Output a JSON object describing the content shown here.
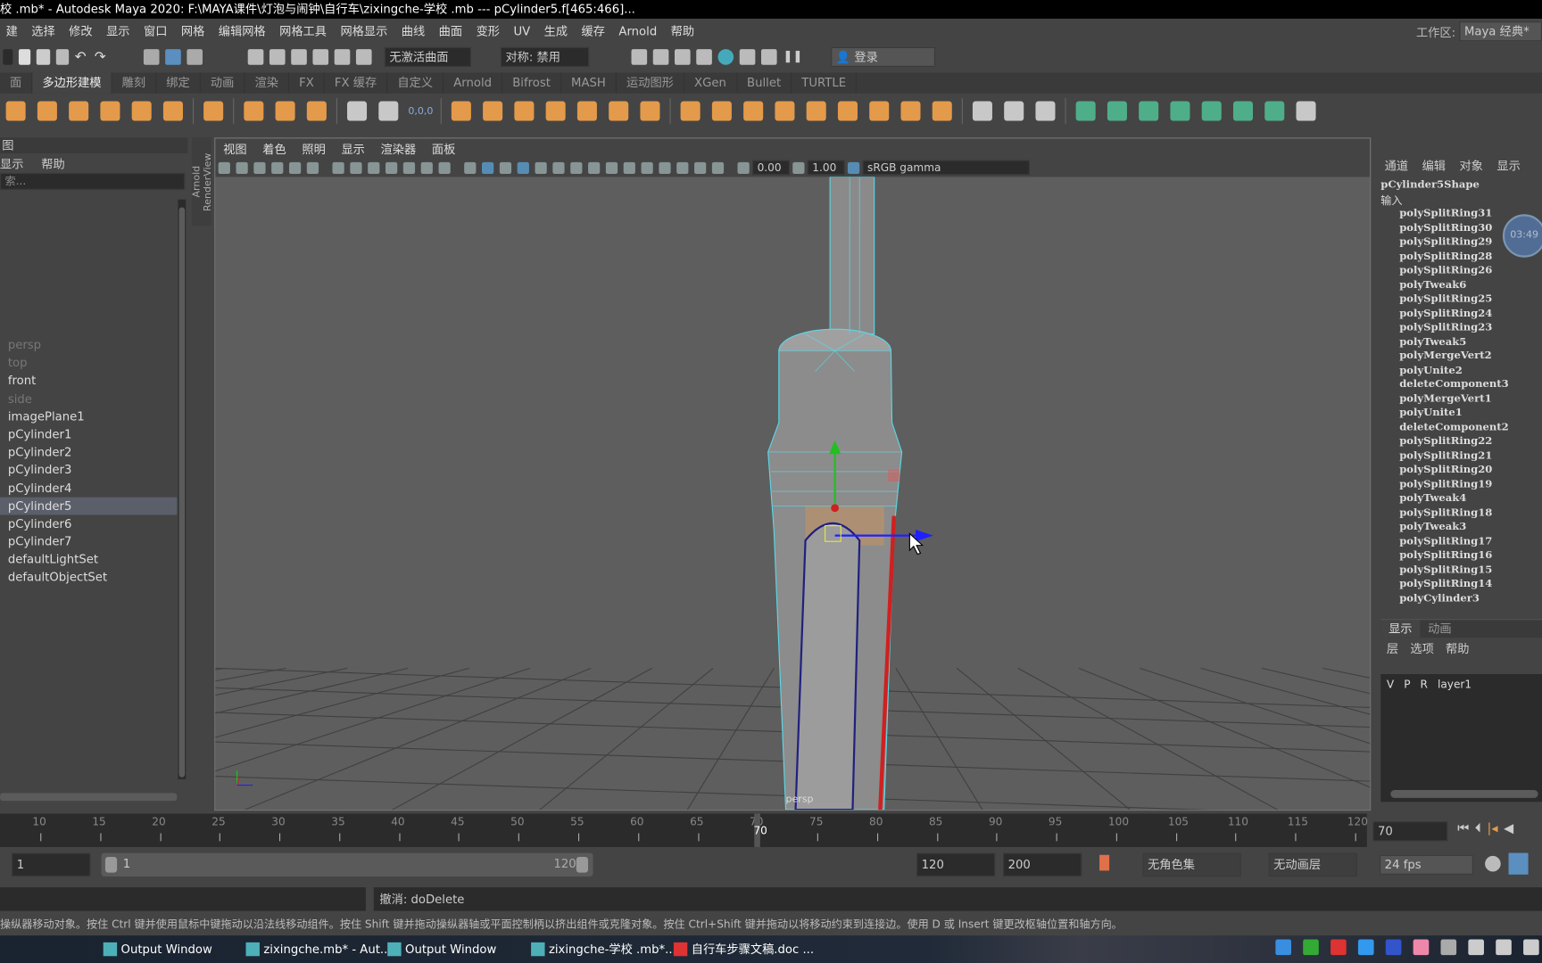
{
  "title": "校 .mb* - Autodesk Maya 2020: F:\\MAYA课件\\灯泡与闹钟\\自行车\\zixingche-学校 .mb   ---   pCylinder5.f[465:466]...",
  "menus": [
    "建",
    "选择",
    "修改",
    "显示",
    "窗口",
    "网格",
    "编辑网格",
    "网格工具",
    "网格显示",
    "曲线",
    "曲面",
    "变形",
    "UV",
    "生成",
    "缓存",
    "Arnold",
    "帮助"
  ],
  "workspace": {
    "label": "工作区:",
    "value": "Maya 经典*"
  },
  "status_line": {
    "live_surface": "无激活曲面",
    "symmetry": "对称: 禁用",
    "login": "登录"
  },
  "shelf_tabs": [
    "面",
    "多边形建模",
    "雕刻",
    "绑定",
    "动画",
    "渲染",
    "FX",
    "FX 缓存",
    "自定义",
    "Arnold",
    "Bifrost",
    "MASH",
    "运动图形",
    "XGen",
    "Bullet",
    "TURTLE"
  ],
  "shelf_active": "多边形建模",
  "shelf_text_icons": {
    "zero": "0,0,0"
  },
  "outliner": {
    "title": "图",
    "menus": [
      "显示",
      "帮助"
    ],
    "search_placeholder": "索...",
    "items": [
      {
        "label": "persp",
        "dim": true
      },
      {
        "label": "top",
        "dim": true
      },
      {
        "label": "front",
        "dim": false
      },
      {
        "label": "side",
        "dim": true
      },
      {
        "label": "imagePlane1"
      },
      {
        "label": "pCylinder1"
      },
      {
        "label": "pCylinder2"
      },
      {
        "label": "pCylinder3"
      },
      {
        "label": "pCylinder4"
      },
      {
        "label": "pCylinder5",
        "selected": true
      },
      {
        "label": "pCylinder6"
      },
      {
        "label": "pCylinder7"
      },
      {
        "label": "defaultLightSet"
      },
      {
        "label": "defaultObjectSet"
      }
    ]
  },
  "arnold_tab": "Arnold RenderView",
  "viewport": {
    "menus": [
      "视图",
      "着色",
      "照明",
      "显示",
      "渲染器",
      "面板"
    ],
    "exposure": "0.00",
    "gamma": "1.00",
    "color_space": "sRGB gamma",
    "camera_label": "persp",
    "manip_colors": {
      "x": "#2020ff",
      "y": "#20c020",
      "z": "#d02020"
    }
  },
  "channel_box": {
    "menus": [
      "通道",
      "编辑",
      "对象",
      "显示"
    ],
    "node": "pCylinder5Shape",
    "inputs_label": "输入",
    "inputs": [
      "polySplitRing31",
      "polySplitRing30",
      "polySplitRing29",
      "polySplitRing28",
      "polySplitRing26",
      "polyTweak6",
      "polySplitRing25",
      "polySplitRing24",
      "polySplitRing23",
      "polyTweak5",
      "polyMergeVert2",
      "polyUnite2",
      "deleteComponent3",
      "polyMergeVert1",
      "polyUnite1",
      "deleteComponent2",
      "polySplitRing22",
      "polySplitRing21",
      "polySplitRing20",
      "polySplitRing19",
      "polyTweak4",
      "polySplitRing18",
      "polyTweak3",
      "polySplitRing17",
      "polySplitRing16",
      "polySplitRing15",
      "polySplitRing14",
      "polyCylinder3"
    ],
    "timer": "03:49"
  },
  "layer_editor": {
    "tabs": [
      "显示",
      "动画"
    ],
    "menus": [
      "层",
      "选项",
      "帮助"
    ],
    "flags": [
      "V",
      "P",
      "R"
    ],
    "layer": "layer1"
  },
  "timeline": {
    "ticks": [
      "10",
      "15",
      "20",
      "25",
      "30",
      "35",
      "40",
      "45",
      "50",
      "55",
      "60",
      "65",
      "70",
      "75",
      "80",
      "85",
      "90",
      "95",
      "100",
      "105",
      "110",
      "115",
      "120"
    ],
    "current": "70",
    "current_field": "70"
  },
  "range": {
    "start": "1",
    "inner_start": "1",
    "inner_end": "120",
    "end": "120",
    "max": "200",
    "character_set": "无角色集",
    "anim_layer": "无动画层",
    "fps": "24 fps"
  },
  "command": {
    "result": "撤消: doDelete"
  },
  "help_line": "操纵器移动对象。按住 Ctrl 键并使用鼠标中键拖动以沿法线移动组件。按住 Shift 键并拖动操纵器轴或平面控制柄以挤出组件或克隆对象。按住 Ctrl+Shift 键并拖动以将移动约束到连接边。使用 D 或 Insert 键更改枢轴位置和轴方向。",
  "taskbar": [
    {
      "label": "Output Window"
    },
    {
      "label": "zixingche.mb* - Aut..."
    },
    {
      "label": "Output Window"
    },
    {
      "label": "zixingche-学校 .mb*..."
    },
    {
      "label": "自行车步骤文稿.doc ..."
    }
  ]
}
